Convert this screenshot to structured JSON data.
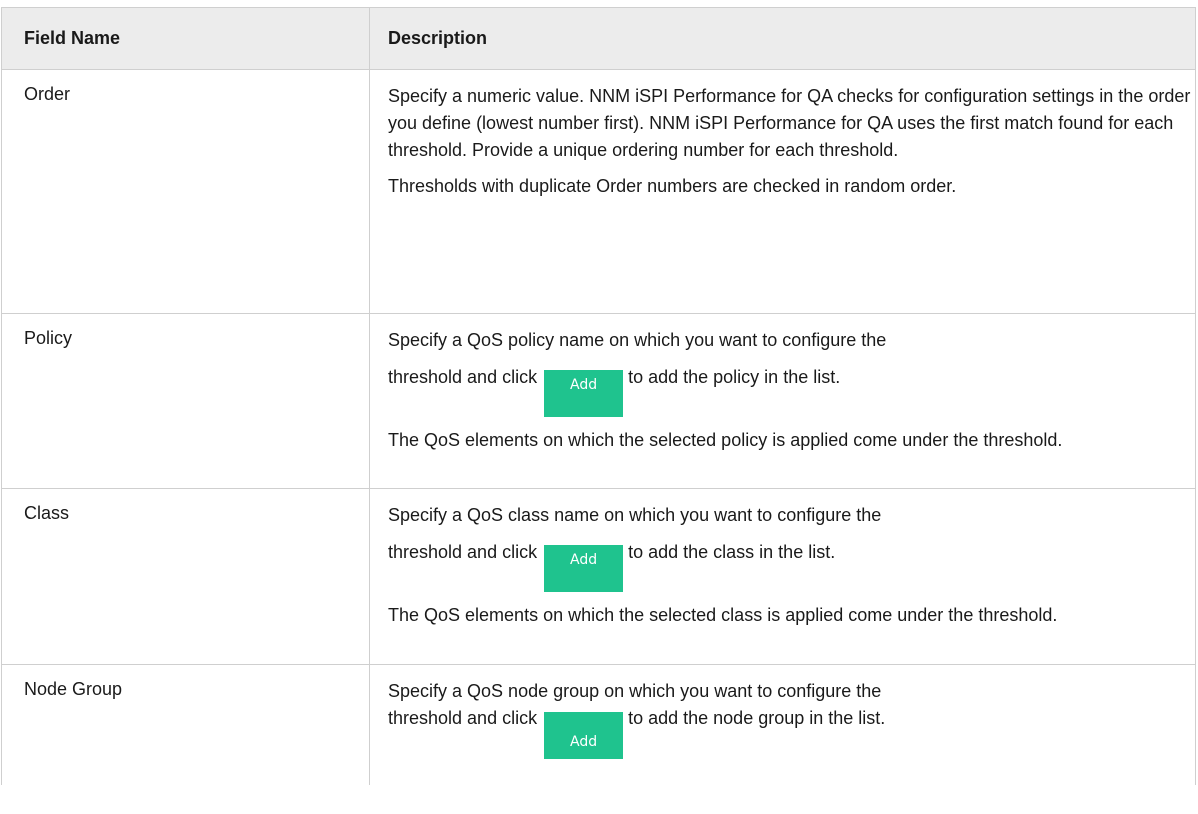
{
  "table": {
    "headers": {
      "field": "Field Name",
      "description": "Description"
    },
    "rows": [
      {
        "field": "Order",
        "p1": "Specify a numeric value. NNM iSPI Performance for QA checks for configuration settings in the order you define (lowest number first). NNM iSPI Performance for QA uses the first match found for each threshold. Provide a unique ordering number for each threshold.",
        "p2": "Thresholds with duplicate Order numbers are checked in random order."
      },
      {
        "field": "Policy",
        "line1": "Specify a QoS policy name on which you want to configure the",
        "before_button": "threshold and click",
        "button_label": "Add",
        "after_button": "to add the policy in the list.",
        "p2": "The QoS elements on which the selected policy is applied come under the threshold."
      },
      {
        "field": "Class",
        "line1": "Specify a QoS class name on which you want to configure the",
        "before_button": "threshold and click",
        "button_label": "Add",
        "after_button": "to add the class in the list.",
        "p2": "The QoS elements on which the selected class is applied come under the threshold."
      },
      {
        "field": "Node Group",
        "line1": "Specify a QoS node group on which you want to configure the",
        "before_button": "threshold and click",
        "button_label": "Add",
        "after_button": "to add the node group in the list."
      }
    ]
  },
  "colors": {
    "header_bg": "#ececec",
    "border": "#cfcfcf",
    "add_button": "#1fc38e"
  }
}
